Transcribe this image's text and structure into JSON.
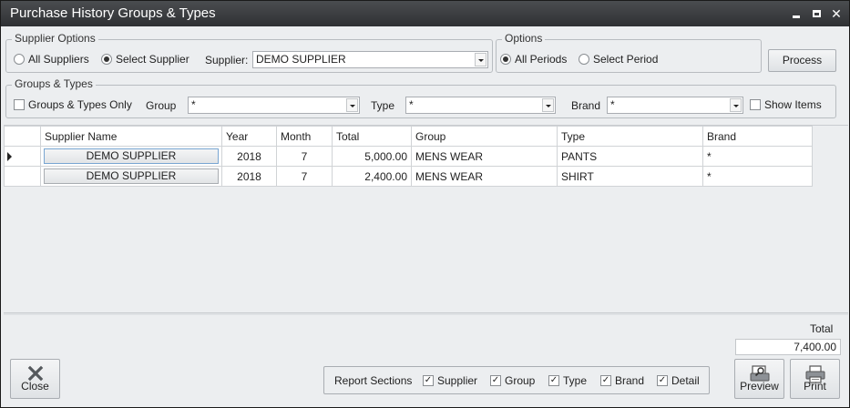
{
  "window": {
    "title": "Purchase History Groups & Types"
  },
  "supplier_options": {
    "legend": "Supplier Options",
    "all_label": "All Suppliers",
    "select_label": "Select Supplier",
    "supplier_label": "Supplier:",
    "supplier_value": "DEMO SUPPLIER",
    "selected": "select"
  },
  "options": {
    "legend": "Options",
    "all_periods_label": "All Periods",
    "select_period_label": "Select  Period",
    "selected": "all"
  },
  "process_label": "Process",
  "groups_types": {
    "legend": "Groups & Types",
    "only_label": "Groups & Types Only",
    "group_label": "Group",
    "group_value": "*",
    "type_label": "Type",
    "type_value": "*",
    "brand_label": "Brand",
    "brand_value": "*",
    "show_items_label": "Show Items"
  },
  "grid": {
    "columns": [
      "Supplier Name",
      "Year",
      "Month",
      "Total",
      "Group",
      "Type",
      "Brand"
    ],
    "rows": [
      {
        "supplier": "DEMO SUPPLIER",
        "year": "2018",
        "month": "7",
        "total": "5,000.00",
        "group": "MENS WEAR",
        "type": "PANTS",
        "brand": "*"
      },
      {
        "supplier": "DEMO SUPPLIER",
        "year": "2018",
        "month": "7",
        "total": "2,400.00",
        "group": "MENS WEAR",
        "type": "SHIRT",
        "brand": "*"
      }
    ]
  },
  "footer": {
    "total_label": "Total",
    "total_value": "7,400.00"
  },
  "report_sections": {
    "label": "Report Sections",
    "supplier": "Supplier",
    "group": "Group",
    "type": "Type",
    "brand": "Brand",
    "detail": "Detail"
  },
  "buttons": {
    "close": "Close",
    "preview": "Preview",
    "print": "Print"
  }
}
